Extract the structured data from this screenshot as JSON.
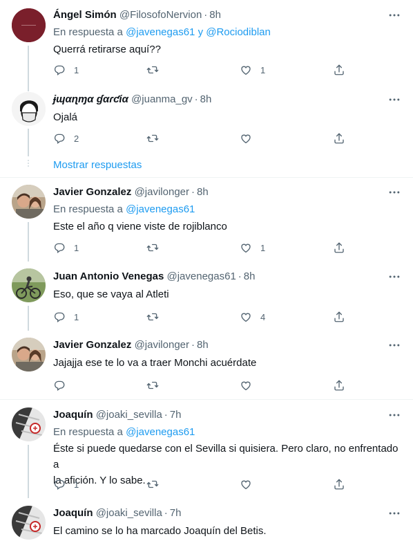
{
  "tweets": [
    {
      "name": "Ángel Simón",
      "handle": "@FilosofoNervion",
      "dot": "·",
      "time": "8h",
      "reply_prefix": "En respuesta a",
      "reply_to_1": "@javenegas61",
      "reply_joiner": "y",
      "reply_to_2": "@Rociodiblan",
      "text": "Querrá retirarse aquí??",
      "reply_count": "1",
      "retweet_count": "",
      "like_count": "1",
      "avatar_text_1": "ÁNGEL",
      "avatar_text_2": "SIMÓN"
    },
    {
      "name": "ɉɰαɳɱα ɠαɾƈία",
      "handle": "@juanma_gv",
      "dot": "·",
      "time": "8h",
      "text": "Ojalá",
      "reply_count": "2",
      "retweet_count": "",
      "like_count": ""
    },
    {
      "name": "Javier Gonzalez",
      "handle": "@javilonger",
      "dot": "·",
      "time": "8h",
      "reply_prefix": "En respuesta a",
      "reply_to_1": "@javenegas61",
      "text": "Este el año q viene viste de rojiblanco",
      "reply_count": "1",
      "retweet_count": "",
      "like_count": "1"
    },
    {
      "name": "Juan Antonio Venegas",
      "handle": "@javenegas61",
      "dot": "·",
      "time": "8h",
      "text": "Eso, que se vaya al Atleti",
      "reply_count": "1",
      "retweet_count": "",
      "like_count": "4"
    },
    {
      "name": "Javier Gonzalez",
      "handle": "@javilonger",
      "dot": "·",
      "time": "8h",
      "text": "Jajajja ese te lo va a traer Monchi acuérdate",
      "reply_count": "",
      "retweet_count": "",
      "like_count": ""
    },
    {
      "name": "Joaquín",
      "handle": "@joaki_sevilla",
      "dot": "·",
      "time": "7h",
      "reply_prefix": "En respuesta a",
      "reply_to_1": "@javenegas61",
      "text_line_1": "Éste si puede quedarse con el Sevilla si quisiera. Pero claro, no enfrentado a",
      "text_line_2": "la afición. Y lo sabe.",
      "reply_count": "1",
      "retweet_count": "",
      "like_count": ""
    },
    {
      "name": "Joaquín",
      "handle": "@joaki_sevilla",
      "dot": "·",
      "time": "7h",
      "text": "El camino se lo ha marcado Joaquín del Betis."
    }
  ],
  "show_replies": "Mostrar respuestas",
  "icons": {
    "reply": "reply-icon",
    "retweet": "retweet-icon",
    "like": "heart-icon",
    "share": "share-icon",
    "more": "more-icon"
  },
  "colors": {
    "accent": "#1d9bf0",
    "secondary_text": "#536471",
    "primary_text": "#0f1419",
    "divider": "#eff3f4",
    "thread_line": "#cfd9de"
  }
}
